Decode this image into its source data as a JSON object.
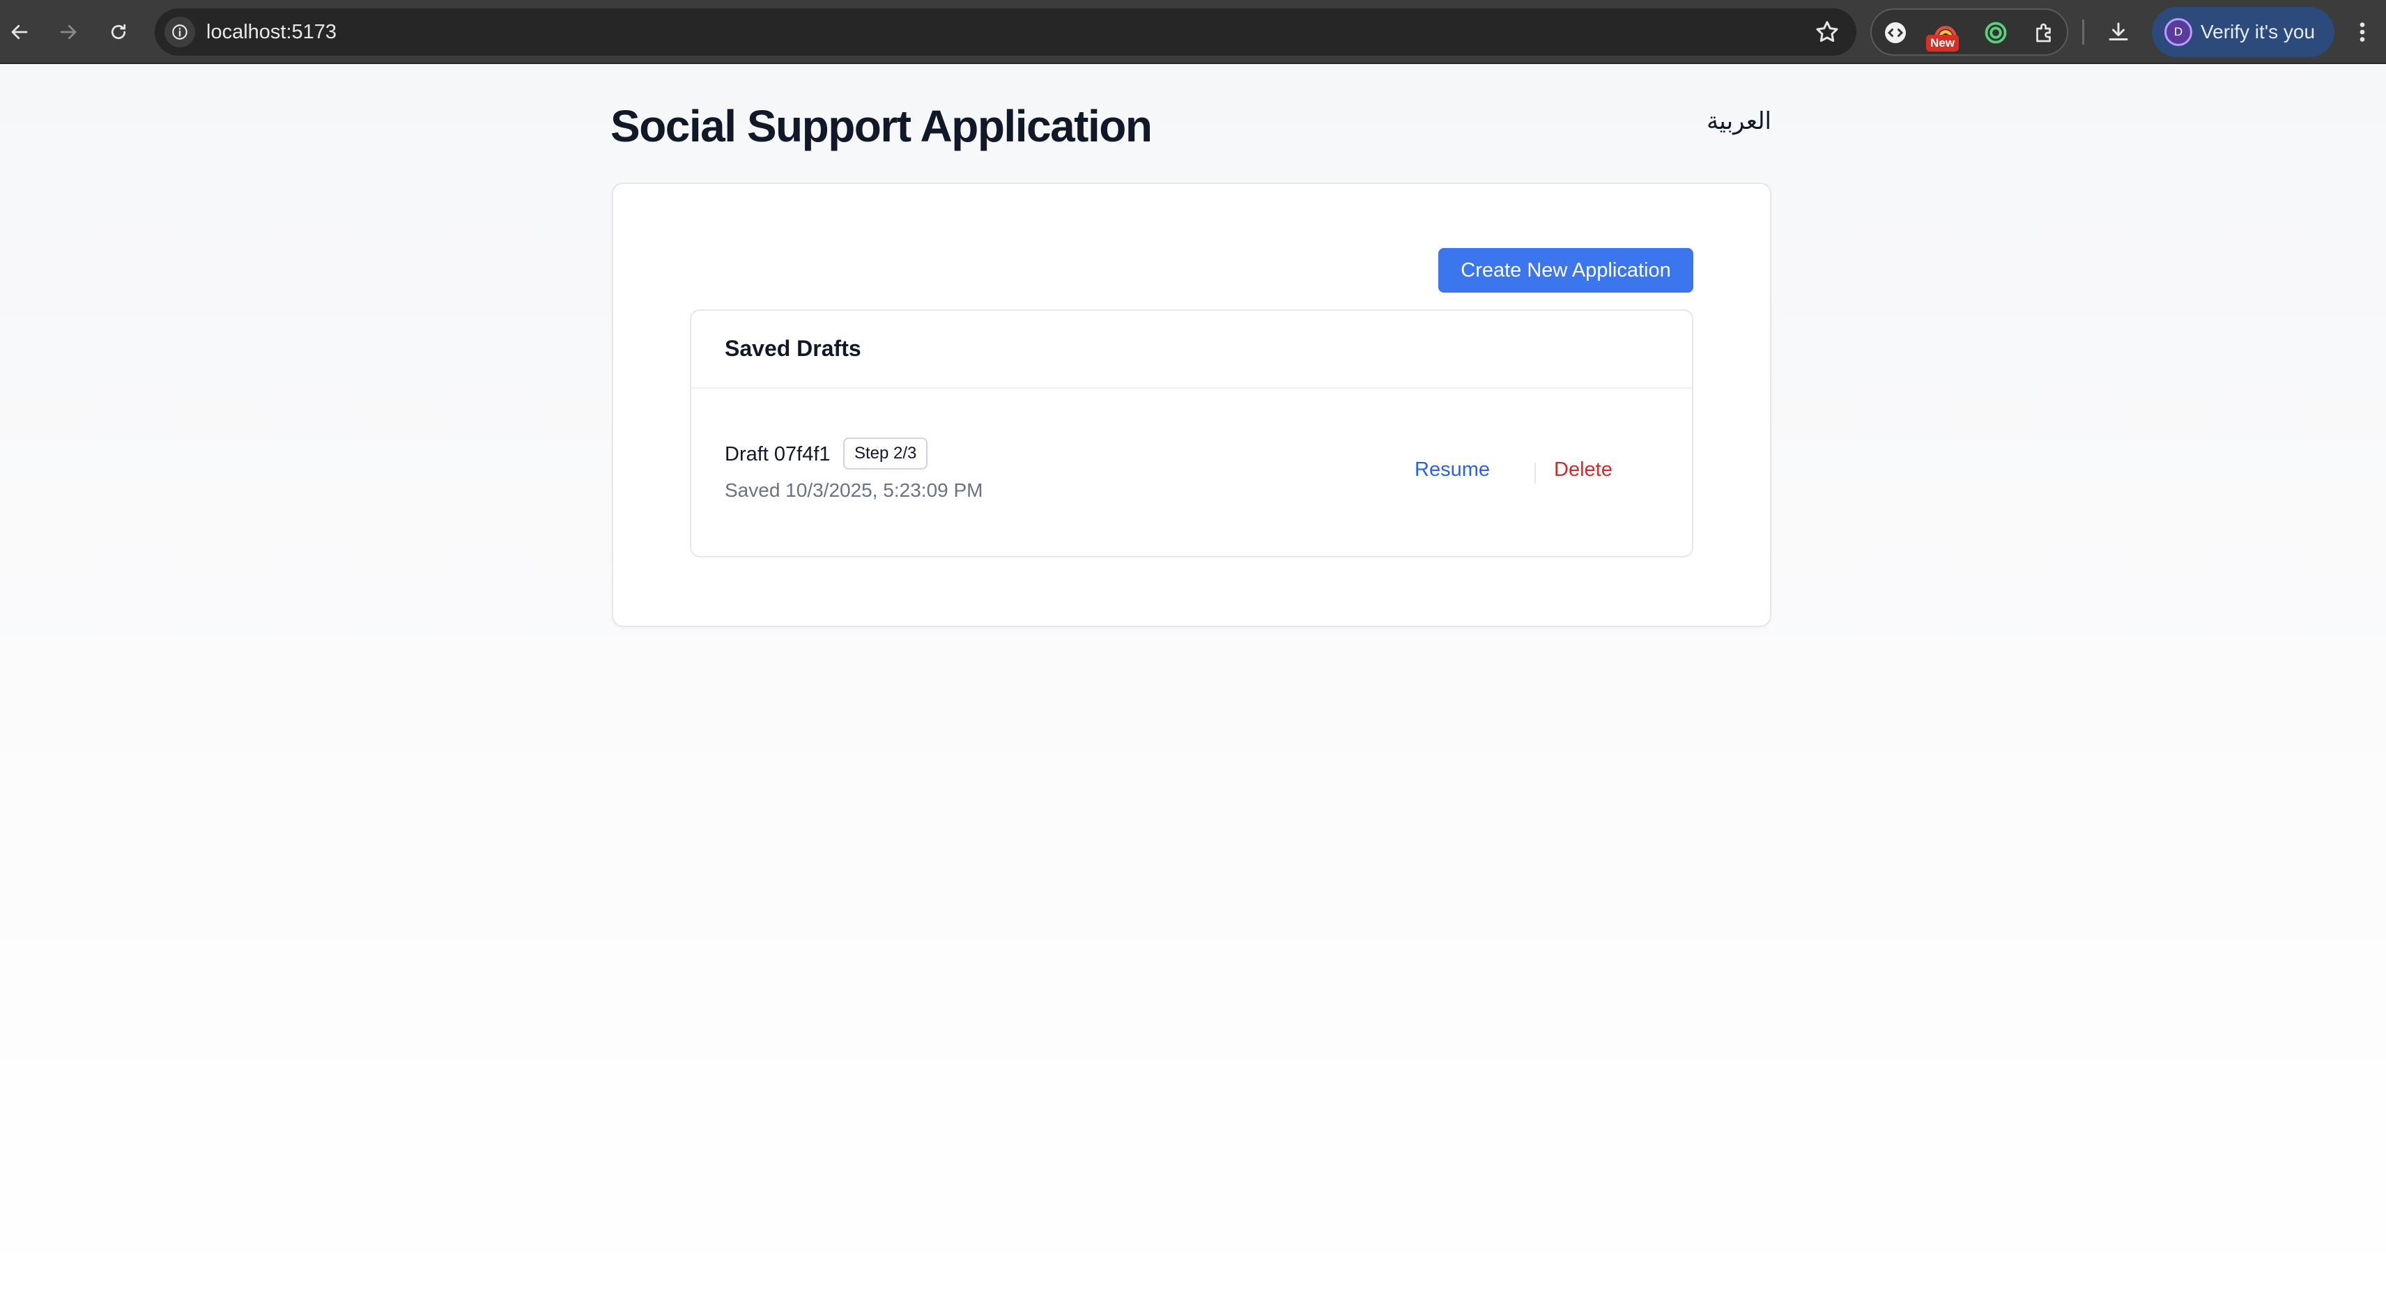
{
  "browser": {
    "url": "localhost:5173",
    "extension_badge": "New",
    "profile": {
      "avatar_initial": "D",
      "label": "Verify it's you"
    }
  },
  "header": {
    "title": "Social Support Application",
    "language_toggle": "العربية"
  },
  "actions": {
    "create_label": "Create New Application"
  },
  "drafts": {
    "title": "Saved Drafts",
    "items": [
      {
        "name": "Draft 07f4f1",
        "step": "Step 2/3",
        "saved": "Saved 10/3/2025, 5:23:09 PM",
        "resume_label": "Resume",
        "delete_label": "Delete"
      }
    ]
  },
  "colors": {
    "primary": "#3b76ee",
    "link": "#2563eb",
    "danger": "#dc2626",
    "page_background": "#f6f7f9"
  }
}
